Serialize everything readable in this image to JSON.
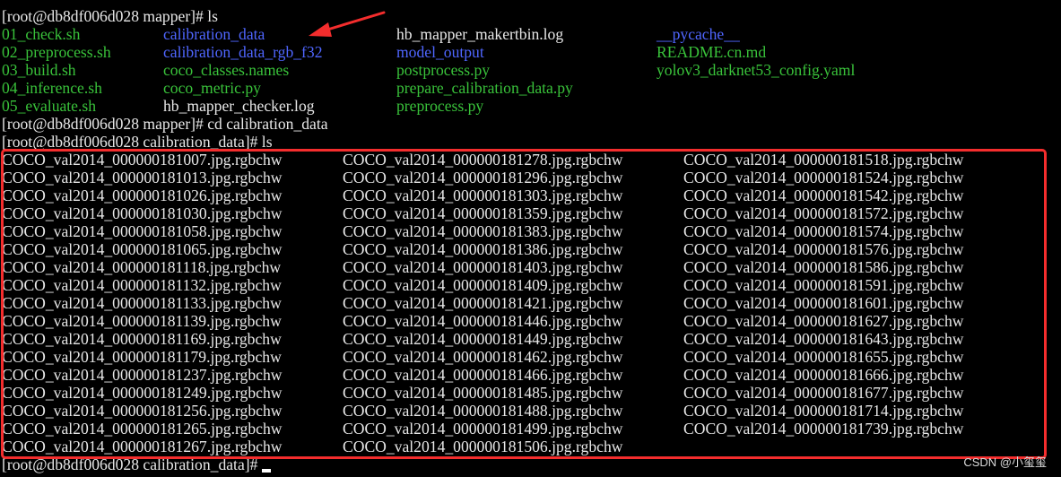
{
  "prompts": {
    "p1": "[root@db8df006d028 mapper]# ls",
    "p2": "[root@db8df006d028 mapper]# cd calibration_data",
    "p3": "[root@db8df006d028 calibration_data]# ls",
    "p4": "[root@db8df006d028 calibration_data]# "
  },
  "mapper_ls": [
    [
      {
        "text": "01_check.sh",
        "color": "green"
      },
      {
        "text": "calibration_data",
        "color": "blue"
      },
      {
        "text": "hb_mapper_makertbin.log",
        "color": "white"
      },
      {
        "text": "__pycache__",
        "color": "blue"
      }
    ],
    [
      {
        "text": "02_preprocess.sh",
        "color": "green"
      },
      {
        "text": "calibration_data_rgb_f32",
        "color": "blue"
      },
      {
        "text": "model_output",
        "color": "blue"
      },
      {
        "text": "README.cn.md",
        "color": "green"
      }
    ],
    [
      {
        "text": "03_build.sh",
        "color": "green"
      },
      {
        "text": "coco_classes.names",
        "color": "green"
      },
      {
        "text": "postprocess.py",
        "color": "green"
      },
      {
        "text": "yolov3_darknet53_config.yaml",
        "color": "green"
      }
    ],
    [
      {
        "text": "04_inference.sh",
        "color": "green"
      },
      {
        "text": "coco_metric.py",
        "color": "green"
      },
      {
        "text": "prepare_calibration_data.py",
        "color": "green"
      },
      {
        "text": "",
        "color": "white"
      }
    ],
    [
      {
        "text": "05_evaluate.sh",
        "color": "green"
      },
      {
        "text": "hb_mapper_checker.log",
        "color": "white"
      },
      {
        "text": "preprocess.py",
        "color": "green"
      },
      {
        "text": "",
        "color": "white"
      }
    ]
  ],
  "calibration_ls": [
    [
      "COCO_val2014_000000181007.jpg.rgbchw",
      "COCO_val2014_000000181278.jpg.rgbchw",
      "COCO_val2014_000000181518.jpg.rgbchw"
    ],
    [
      "COCO_val2014_000000181013.jpg.rgbchw",
      "COCO_val2014_000000181296.jpg.rgbchw",
      "COCO_val2014_000000181524.jpg.rgbchw"
    ],
    [
      "COCO_val2014_000000181026.jpg.rgbchw",
      "COCO_val2014_000000181303.jpg.rgbchw",
      "COCO_val2014_000000181542.jpg.rgbchw"
    ],
    [
      "COCO_val2014_000000181030.jpg.rgbchw",
      "COCO_val2014_000000181359.jpg.rgbchw",
      "COCO_val2014_000000181572.jpg.rgbchw"
    ],
    [
      "COCO_val2014_000000181058.jpg.rgbchw",
      "COCO_val2014_000000181383.jpg.rgbchw",
      "COCO_val2014_000000181574.jpg.rgbchw"
    ],
    [
      "COCO_val2014_000000181065.jpg.rgbchw",
      "COCO_val2014_000000181386.jpg.rgbchw",
      "COCO_val2014_000000181576.jpg.rgbchw"
    ],
    [
      "COCO_val2014_000000181118.jpg.rgbchw",
      "COCO_val2014_000000181403.jpg.rgbchw",
      "COCO_val2014_000000181586.jpg.rgbchw"
    ],
    [
      "COCO_val2014_000000181132.jpg.rgbchw",
      "COCO_val2014_000000181409.jpg.rgbchw",
      "COCO_val2014_000000181591.jpg.rgbchw"
    ],
    [
      "COCO_val2014_000000181133.jpg.rgbchw",
      "COCO_val2014_000000181421.jpg.rgbchw",
      "COCO_val2014_000000181601.jpg.rgbchw"
    ],
    [
      "COCO_val2014_000000181139.jpg.rgbchw",
      "COCO_val2014_000000181446.jpg.rgbchw",
      "COCO_val2014_000000181627.jpg.rgbchw"
    ],
    [
      "COCO_val2014_000000181169.jpg.rgbchw",
      "COCO_val2014_000000181449.jpg.rgbchw",
      "COCO_val2014_000000181643.jpg.rgbchw"
    ],
    [
      "COCO_val2014_000000181179.jpg.rgbchw",
      "COCO_val2014_000000181462.jpg.rgbchw",
      "COCO_val2014_000000181655.jpg.rgbchw"
    ],
    [
      "COCO_val2014_000000181237.jpg.rgbchw",
      "COCO_val2014_000000181466.jpg.rgbchw",
      "COCO_val2014_000000181666.jpg.rgbchw"
    ],
    [
      "COCO_val2014_000000181249.jpg.rgbchw",
      "COCO_val2014_000000181485.jpg.rgbchw",
      "COCO_val2014_000000181677.jpg.rgbchw"
    ],
    [
      "COCO_val2014_000000181256.jpg.rgbchw",
      "COCO_val2014_000000181488.jpg.rgbchw",
      "COCO_val2014_000000181714.jpg.rgbchw"
    ],
    [
      "COCO_val2014_000000181265.jpg.rgbchw",
      "COCO_val2014_000000181499.jpg.rgbchw",
      "COCO_val2014_000000181739.jpg.rgbchw"
    ],
    [
      "COCO_val2014_000000181267.jpg.rgbchw",
      "COCO_val2014_000000181506.jpg.rgbchw",
      ""
    ]
  ],
  "watermark": "CSDN @小玺玺",
  "annotation_colors": {
    "highlight": "#f42d2d",
    "arrow": "#f42d2d"
  },
  "icons": {
    "arrow": "annotation-arrow-icon",
    "cursor": "terminal-cursor-icon"
  }
}
